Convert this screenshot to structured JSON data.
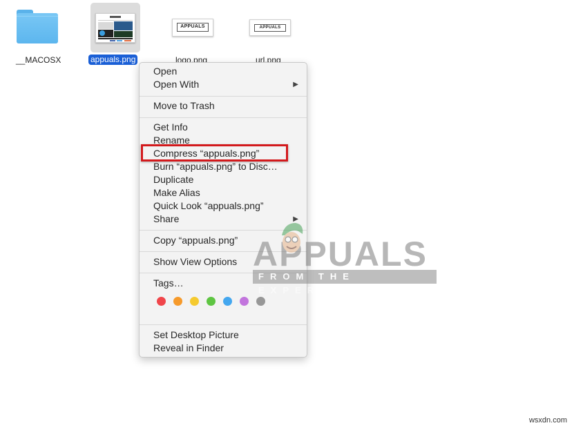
{
  "files": [
    {
      "name": "__MACOSX",
      "icon": "folder-icon",
      "selected": false
    },
    {
      "name": "appuals.png",
      "icon": "image-thumbnail",
      "selected": true
    },
    {
      "name": "logo.png",
      "icon": "image-thumbnail",
      "selected": false
    },
    {
      "name": "url.png",
      "icon": "image-thumbnail",
      "selected": false
    }
  ],
  "thumb_text": {
    "logo": "APPUALS",
    "url": "APPUALS"
  },
  "context_menu": {
    "groups": [
      [
        {
          "label": "Open"
        },
        {
          "label": "Open With",
          "submenu": true
        }
      ],
      [
        {
          "label": "Move to Trash"
        }
      ],
      [
        {
          "label": "Get Info"
        },
        {
          "label": "Rename"
        },
        {
          "label": "Compress “appuals.png”",
          "highlighted": true
        },
        {
          "label": "Burn “appuals.png” to Disc…"
        },
        {
          "label": "Duplicate"
        },
        {
          "label": "Make Alias"
        },
        {
          "label": "Quick Look “appuals.png”"
        },
        {
          "label": "Share",
          "submenu": true
        }
      ],
      [
        {
          "label": "Copy “appuals.png”"
        }
      ],
      [
        {
          "label": "Show View Options"
        }
      ],
      [
        {
          "label": "Tags…"
        }
      ],
      [
        {
          "label": "Set Desktop Picture"
        },
        {
          "label": "Reveal in Finder"
        }
      ]
    ],
    "submenu_arrow": "▶",
    "tags": [
      {
        "name": "red",
        "color": "#f0454a"
      },
      {
        "name": "orange",
        "color": "#f69a2b"
      },
      {
        "name": "yellow",
        "color": "#f5ca2f"
      },
      {
        "name": "green",
        "color": "#5ec542"
      },
      {
        "name": "blue",
        "color": "#44a7ef"
      },
      {
        "name": "purple",
        "color": "#c275dd"
      },
      {
        "name": "gray",
        "color": "#979797"
      }
    ]
  },
  "watermark": {
    "title": "APPUALS",
    "tagline": "FROM THE EXPERTS!"
  },
  "site_credit": "wsxdn.com",
  "colors": {
    "selection": "#1a5fd6",
    "highlight_box": "#d3191c",
    "folder": "#6cbff3"
  }
}
